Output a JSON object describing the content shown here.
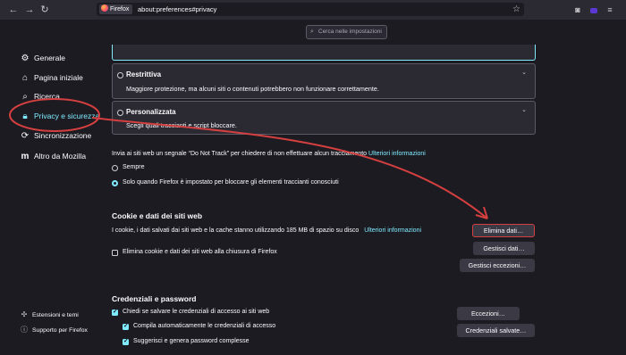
{
  "toolbar": {
    "back_icon": "arrow-left-icon",
    "forward_icon": "arrow-right-icon",
    "reload_icon": "reload-icon",
    "identity_label": "Firefox",
    "url": "about:preferences#privacy",
    "star_icon": "star-icon",
    "pocket_icon": "pocket-icon",
    "menu_icon": "hamburger-menu-icon"
  },
  "search": {
    "placeholder": "Cerca nelle impostazioni"
  },
  "sidebar": {
    "items": [
      {
        "label": "Generale",
        "icon": "gear-icon"
      },
      {
        "label": "Pagina iniziale",
        "icon": "home-icon"
      },
      {
        "label": "Ricerca",
        "icon": "search-icon"
      },
      {
        "label": "Privacy e sicurezza",
        "icon": "lock-icon",
        "selected": true
      },
      {
        "label": "Sincronizzazione",
        "icon": "sync-icon"
      },
      {
        "label": "Altro da Mozilla",
        "icon": "mozilla-m-icon"
      }
    ],
    "footer": [
      {
        "label": "Estensioni e temi",
        "icon": "puzzle-icon"
      },
      {
        "label": "Supporto per Firefox",
        "icon": "help-icon"
      }
    ]
  },
  "tracking": {
    "strict": {
      "title": "Restrittiva",
      "desc": "Maggiore protezione, ma alcuni siti o contenuti potrebbero non funzionare correttamente."
    },
    "custom": {
      "title": "Personalizzata",
      "desc": "Scegli quali traccianti e script bloccare."
    },
    "dnt_text": "Invia ai siti web un segnale “Do Not Track” per chiedere di non effettuare alcun tracciamento",
    "dnt_link": "Ulteriori informazioni",
    "dnt_always": "Sempre",
    "dnt_only": "Solo quando Firefox è impostato per bloccare gli elementi traccianti conosciuti"
  },
  "cookies": {
    "heading": "Cookie e dati dei siti web",
    "usage_text": "I cookie, i dati salvati dai siti web e la cache stanno utilizzando 185 MB di spazio su disco",
    "usage_link": "Ulteriori informazioni",
    "clear_button": "Elimina dati…",
    "manage_data_button": "Gestisci dati…",
    "manage_exceptions_button": "Gestisci eccezioni…",
    "delete_on_close": "Elimina cookie e dati dei siti web alla chiusura di Firefox"
  },
  "logins": {
    "heading": "Credenziali e password",
    "ask_save": "Chiedi se salvare le credenziali di accesso ai siti web",
    "autofill": "Compila automaticamente le credenziali di accesso",
    "suggest": "Suggerisci e genera password complesse",
    "exceptions_button": "Eccezioni…",
    "saved_logins_button": "Credenziali salvate…"
  },
  "colors": {
    "accent": "#80ebff",
    "annotation": "#d43f3f",
    "background": "#1c1b22"
  }
}
